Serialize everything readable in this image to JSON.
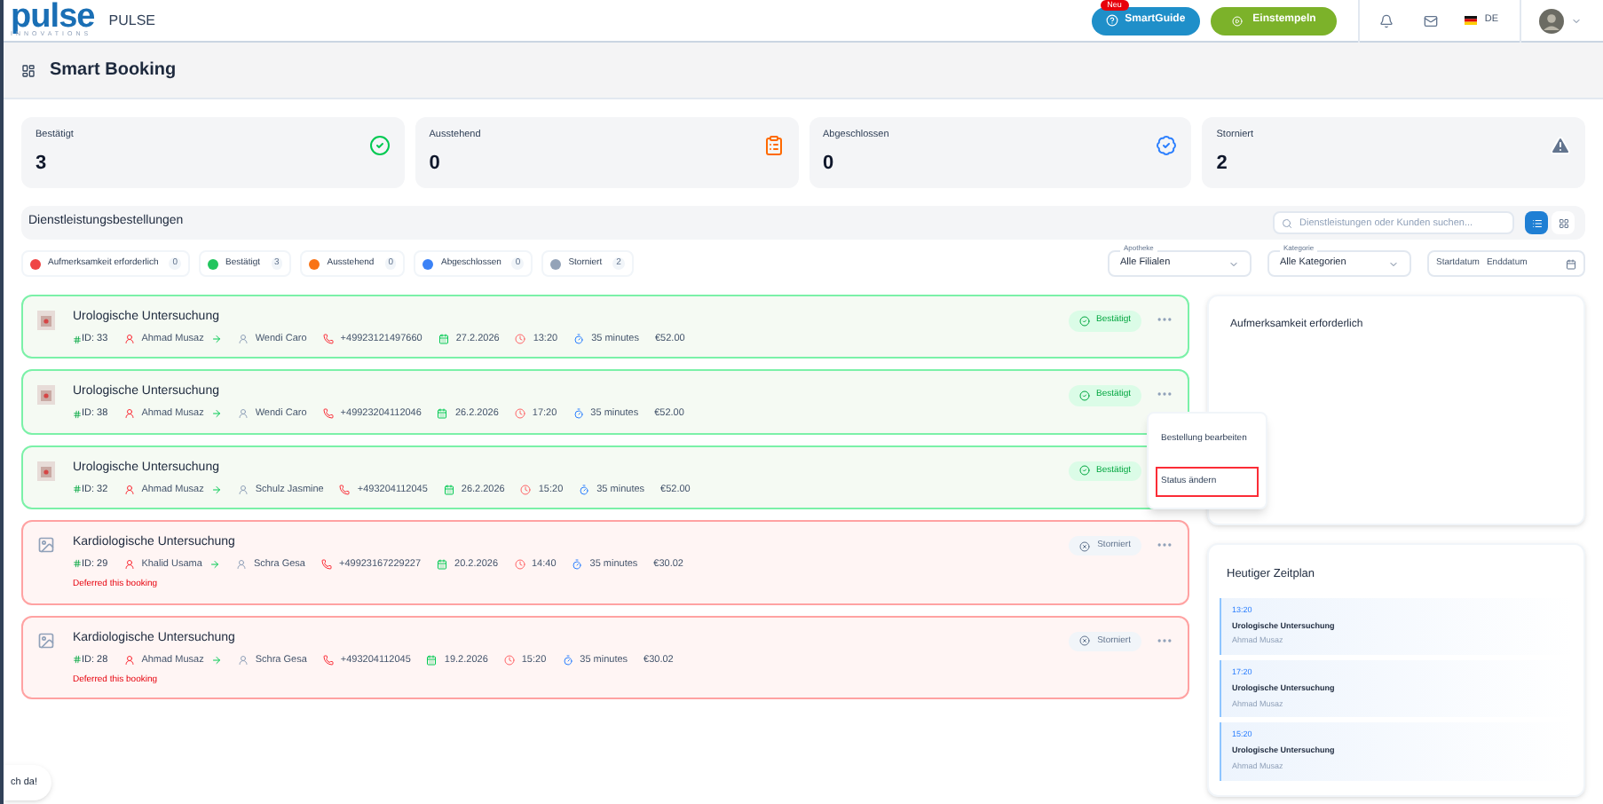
{
  "header": {
    "logo": "pulse",
    "logo_tagline": "INNOVATIONS",
    "app_name": "PULSE",
    "smartguide": {
      "label": "SmartGuide",
      "badge": "Neu"
    },
    "clock_in": "Einstempeln",
    "language": "DE"
  },
  "page_title": "Smart Booking",
  "stats": [
    {
      "label": "Bestätigt",
      "value": "3",
      "kind": "confirmed"
    },
    {
      "label": "Ausstehend",
      "value": "0",
      "kind": "pending"
    },
    {
      "label": "Abgeschlossen",
      "value": "0",
      "kind": "completed"
    },
    {
      "label": "Storniert",
      "value": "2",
      "kind": "cancelled"
    }
  ],
  "section": {
    "title": "Dienstleistungsbestellungen",
    "search_placeholder": "Dienstleistungen oder Kunden suchen...",
    "views": [
      {
        "kind": "list",
        "selected": true
      },
      {
        "kind": "grid",
        "selected": false
      }
    ]
  },
  "status_filters": [
    {
      "label": "Aufmerksamkeit erforderlich",
      "count": "0",
      "color": "#ef4444"
    },
    {
      "label": "Bestätigt",
      "count": "3",
      "color": "#22c55e"
    },
    {
      "label": "Ausstehend",
      "count": "0",
      "color": "#f97316"
    },
    {
      "label": "Abgeschlossen",
      "count": "0",
      "color": "#3b82f6"
    },
    {
      "label": "Storniert",
      "count": "2",
      "color": "#94a3b8"
    }
  ],
  "selects": [
    {
      "label": "Apotheke",
      "value": "Alle Filialen"
    },
    {
      "label": "Kategorie",
      "value": "Alle Kategorien"
    }
  ],
  "date_range": {
    "start_placeholder": "Startdatum",
    "end_placeholder": "Enddatum"
  },
  "bookings": [
    {
      "title": "Urologische Untersuchung",
      "id": "ID: 33",
      "customer": "Ahmad Musaz",
      "staff": "Wendi Caro",
      "phone": "+49923121497660",
      "date": "27.2.2026",
      "time": "13:20",
      "duration": "35 minutes",
      "price": "€52.00",
      "status": "Bestätigt",
      "kind": "confirmed",
      "actions_visible": true
    },
    {
      "title": "Urologische Untersuchung",
      "id": "ID: 38",
      "customer": "Ahmad Musaz",
      "staff": "Wendi Caro",
      "phone": "+49923204112046",
      "date": "26.2.2026",
      "time": "17:20",
      "duration": "35 minutes",
      "price": "€52.00",
      "status": "Bestätigt",
      "kind": "confirmed",
      "actions_visible": true
    },
    {
      "title": "Urologische Untersuchung",
      "id": "ID: 32",
      "customer": "Ahmad Musaz",
      "staff": "Schulz Jasmine",
      "phone": "+493204112045",
      "date": "26.2.2026",
      "time": "15:20",
      "duration": "35 minutes",
      "price": "€52.00",
      "status": "Bestätigt",
      "kind": "confirmed",
      "actions_visible": false
    },
    {
      "title": "Kardiologische Untersuchung",
      "id": "ID: 29",
      "customer": "Khalid Usama",
      "staff": "Schra Gesa",
      "phone": "+49923167229227",
      "date": "20.2.2026",
      "time": "14:40",
      "duration": "35 minutes",
      "price": "€30.02",
      "status": "Storniert",
      "kind": "cancelled",
      "note": "Deferred this booking",
      "actions_visible": true
    },
    {
      "title": "Kardiologische Untersuchung",
      "id": "ID: 28",
      "customer": "Ahmad Musaz",
      "staff": "Schra Gesa",
      "phone": "+493204112045",
      "date": "19.2.2026",
      "time": "15:20",
      "duration": "35 minutes",
      "price": "€30.02",
      "status": "Storniert",
      "kind": "cancelled",
      "note": "Deferred this booking",
      "actions_visible": true
    }
  ],
  "menu": {
    "items": [
      {
        "label": "Bestellung bearbeiten",
        "selected": false
      },
      {
        "label": "Status ändern",
        "selected": true
      }
    ]
  },
  "attention": {
    "title": "Aufmerksamkeit erforderlich"
  },
  "schedule": {
    "title": "Heutiger Zeitplan",
    "items": [
      {
        "time": "13:20",
        "title": "Urologische Untersuchung",
        "customer": "Ahmad Musaz"
      },
      {
        "time": "17:20",
        "title": "Urologische Untersuchung",
        "customer": "Ahmad Musaz"
      },
      {
        "time": "15:20",
        "title": "Urologische Untersuchung",
        "customer": "Ahmad Musaz"
      }
    ]
  },
  "chat_bubble": "ch da!"
}
